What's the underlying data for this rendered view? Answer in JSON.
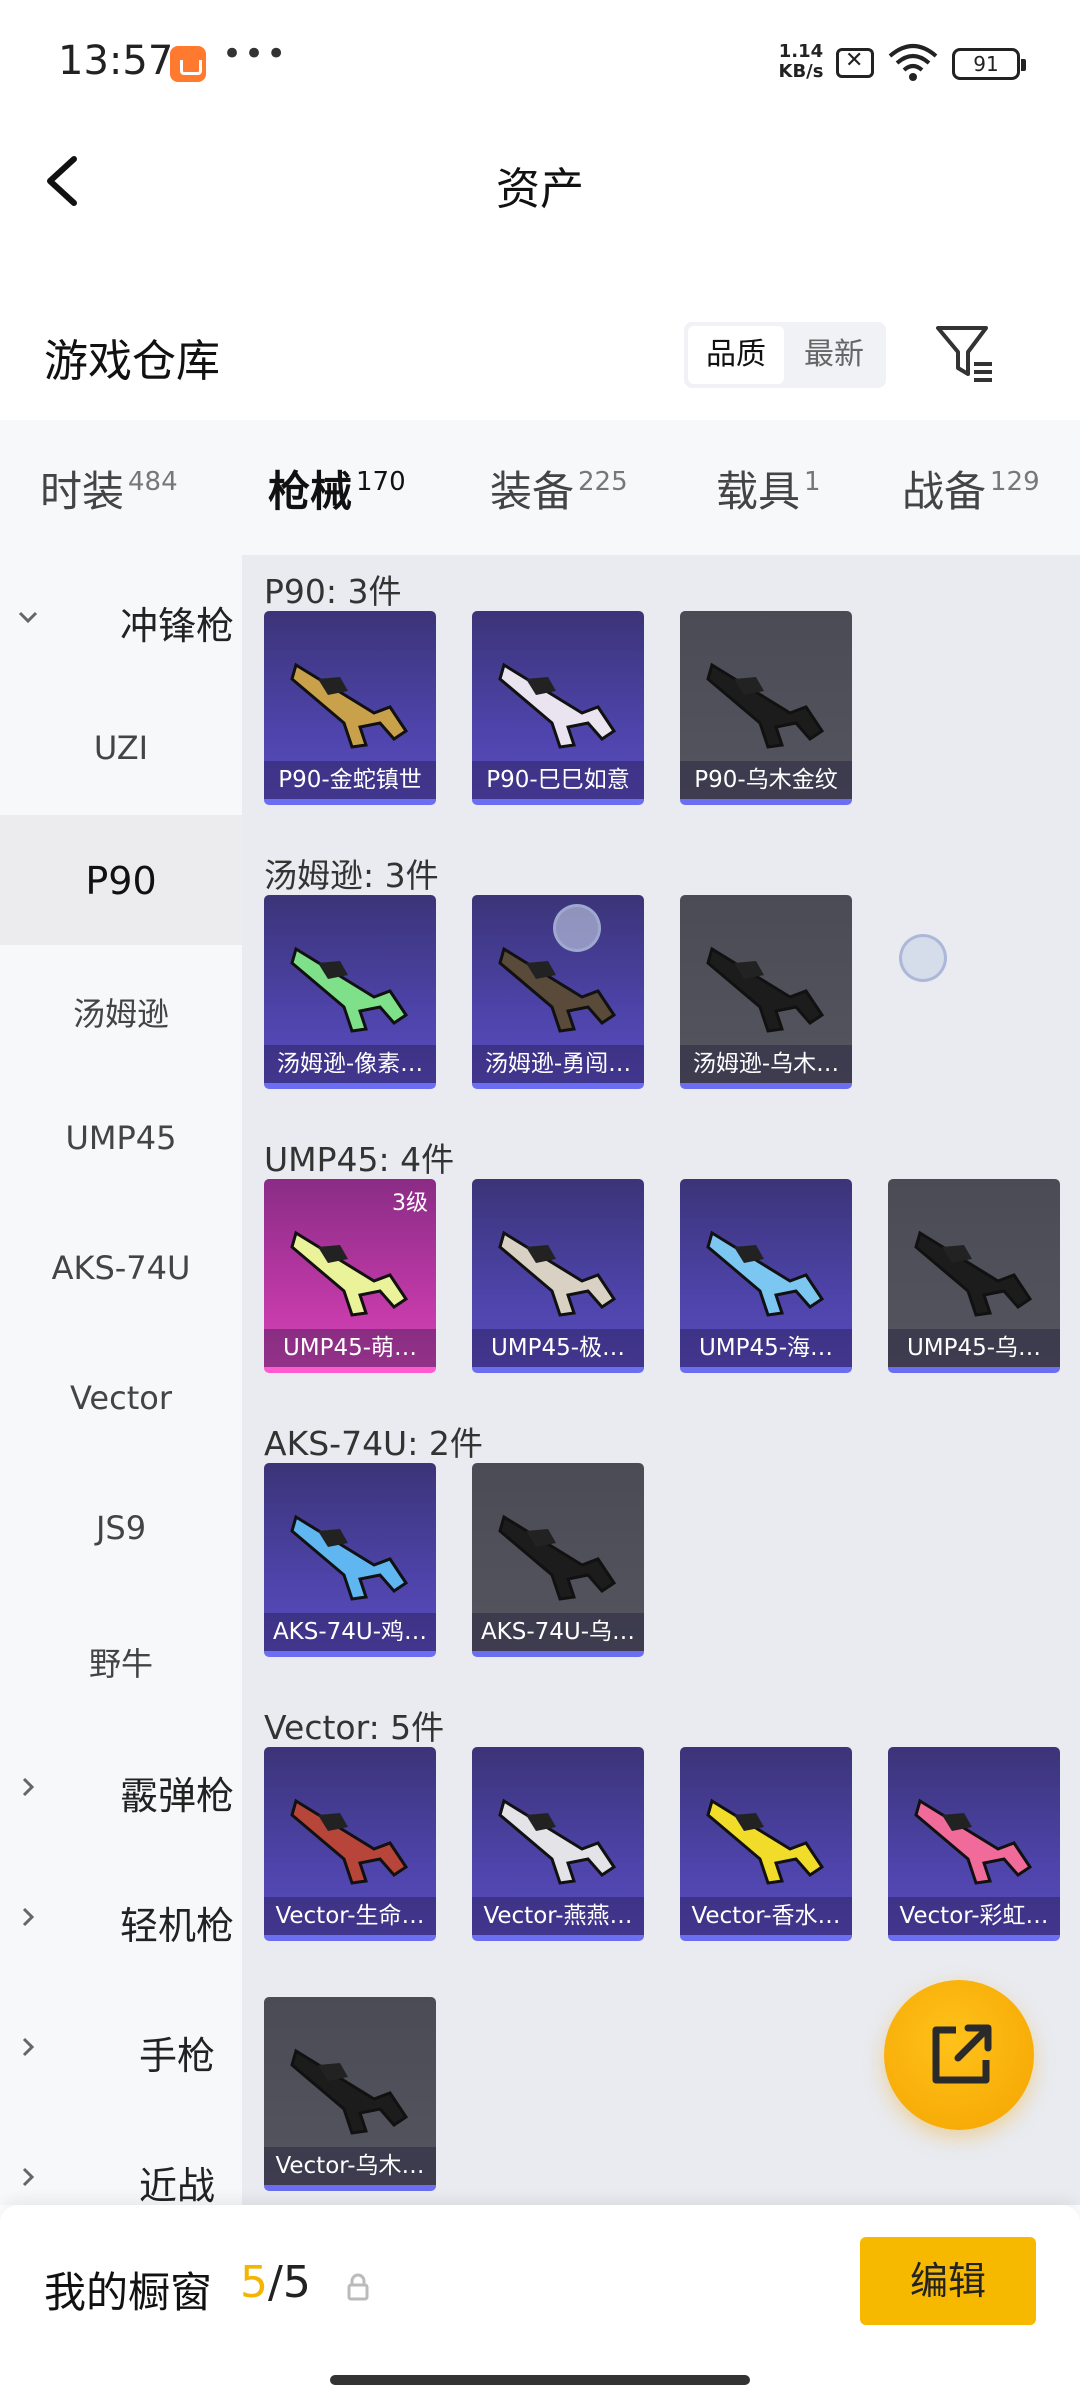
{
  "status_bar": {
    "time": "13:57",
    "dots": "•••",
    "net_speed": "1.14",
    "net_unit": "KB/s",
    "battery": "91"
  },
  "nav": {
    "title": "资产"
  },
  "warehouse": {
    "title": "游戏仓库",
    "sort_options": [
      "品质",
      "最新"
    ],
    "sort_selected": "品质"
  },
  "tabs": [
    {
      "label": "时装",
      "count": "484"
    },
    {
      "label": "枪械",
      "count": "170"
    },
    {
      "label": "装备",
      "count": "225"
    },
    {
      "label": "载具",
      "count": "1"
    },
    {
      "label": "战备",
      "count": "129"
    }
  ],
  "sidebar": {
    "groups": [
      {
        "label": "冲锋枪",
        "expanded": true
      },
      {
        "label": "霰弹枪",
        "expanded": false
      },
      {
        "label": "轻机枪",
        "expanded": false
      },
      {
        "label": "手枪",
        "expanded": false
      },
      {
        "label": "近战",
        "expanded": false
      }
    ],
    "items": [
      "UZI",
      "P90",
      "汤姆逊",
      "UMP45",
      "AKS-74U",
      "Vector",
      "JS9",
      "野牛"
    ],
    "selected": "P90"
  },
  "sections": [
    {
      "title": "P90: 3件",
      "items": [
        {
          "name": "P90-金蛇镇世",
          "style": "purple",
          "color": "#c9a14a"
        },
        {
          "name": "P90-巳巳如意",
          "style": "purple",
          "color": "#e9e4f0"
        },
        {
          "name": "P90-乌木金纹",
          "style": "gray",
          "color": "#1c1c1c"
        }
      ]
    },
    {
      "title": "汤姆逊: 3件",
      "items": [
        {
          "name": "汤姆逊-像素…",
          "style": "purple",
          "color": "#7fe08a"
        },
        {
          "name": "汤姆逊-勇闯…",
          "style": "purple",
          "color": "#5a4a3a"
        },
        {
          "name": "汤姆逊-乌木…",
          "style": "gray",
          "color": "#1c1c1c"
        }
      ]
    },
    {
      "title": "UMP45: 4件",
      "items": [
        {
          "name": "UMP45-萌…",
          "style": "pink",
          "color": "#eaf29a",
          "level": "3级"
        },
        {
          "name": "UMP45-极…",
          "style": "purple",
          "color": "#d9d2c4"
        },
        {
          "name": "UMP45-海…",
          "style": "purple",
          "color": "#7cc7f2"
        },
        {
          "name": "UMP45-乌…",
          "style": "gray",
          "color": "#1c1c1c"
        }
      ]
    },
    {
      "title": "AKS-74U: 2件",
      "items": [
        {
          "name": "AKS-74U-鸡…",
          "style": "purple",
          "color": "#5fb6f0"
        },
        {
          "name": "AKS-74U-乌…",
          "style": "gray",
          "color": "#1c1c1c"
        }
      ]
    },
    {
      "title": "Vector: 5件",
      "items": [
        {
          "name": "Vector-生命…",
          "style": "purple",
          "color": "#b8453a"
        },
        {
          "name": "Vector-燕燕…",
          "style": "purple",
          "color": "#e3e3e8"
        },
        {
          "name": "Vector-香水…",
          "style": "purple",
          "color": "#f2dc2a"
        },
        {
          "name": "Vector-彩虹…",
          "style": "purple",
          "color": "#f06a9a"
        },
        {
          "name": "Vector-乌木…",
          "style": "gray",
          "color": "#1c1c1c"
        }
      ]
    }
  ],
  "bottom": {
    "label": "我的橱窗",
    "current": "5",
    "separator": "/",
    "max": "5",
    "edit_label": "编辑"
  },
  "colors": {
    "accent": "#f5b400",
    "card_border": "#6b6ef0"
  },
  "icons": {
    "back": "chevron-left-icon",
    "filter": "filter-icon",
    "lock": "lock-icon",
    "share": "share-icon"
  }
}
